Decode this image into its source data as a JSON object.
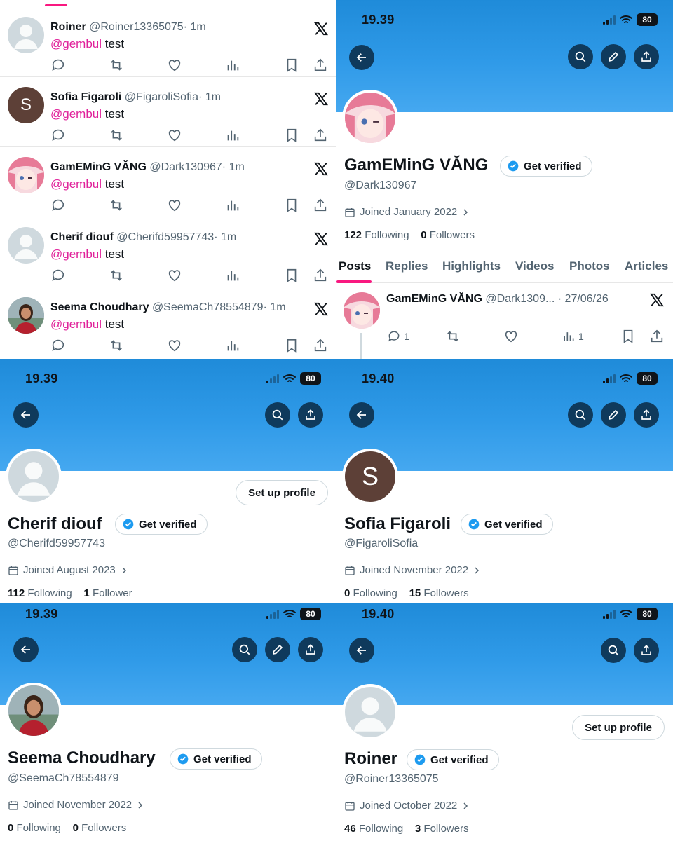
{
  "feed": {
    "tweets": [
      {
        "name": "Roiner",
        "handle": "@Roiner13365075",
        "time": "· 1m",
        "mention": "@gembul",
        "text": " test"
      },
      {
        "name": "Sofia Figaroli",
        "handle": "@FigaroliSofia",
        "time": "· 1m",
        "mention": "@gembul",
        "text": " test",
        "initial": "S"
      },
      {
        "name": "GamEMinG VĂNG",
        "handle": "@Dark130967",
        "time": "· 1m",
        "mention": "@gembul",
        "text": " test"
      },
      {
        "name": "Cherif diouf",
        "handle": "@Cherifd59957743",
        "time": "· 1m",
        "mention": "@gembul",
        "text": " test"
      },
      {
        "name": "Seema Choudhary",
        "handle": "@SeemaCh78554879",
        "time": "· 1m",
        "mention": "@gembul",
        "text": " test"
      }
    ]
  },
  "profiles": {
    "gaming": {
      "time": "19.39",
      "battery": "80",
      "name": "GamEMinG VĂNG",
      "verify_label": "Get verified",
      "handle": "@Dark130967",
      "joined": "Joined January 2022",
      "following_count": "122",
      "following_label": "Following",
      "followers_count": "0",
      "followers_label": "Followers",
      "tabs": [
        "Posts",
        "Replies",
        "Highlights",
        "Videos",
        "Photos",
        "Articles"
      ],
      "post": {
        "name": "GamEMinG VĂNG",
        "handle": "@Dark1309...",
        "date": "· 27/06/26",
        "replies": "1",
        "views": "1"
      }
    },
    "cherif": {
      "time": "19.39",
      "battery": "80",
      "name": "Cherif diouf",
      "verify_label": "Get verified",
      "handle": "@Cherifd59957743",
      "joined": "Joined August 2023",
      "setup_label": "Set up profile",
      "following_count": "112",
      "following_label": "Following",
      "followers_count": "1",
      "followers_label": "Follower"
    },
    "sofia": {
      "time": "19.40",
      "battery": "80",
      "name": "Sofia Figaroli",
      "verify_label": "Get verified",
      "handle": "@FigaroliSofia",
      "joined": "Joined November 2022",
      "initial": "S",
      "following_count": "0",
      "following_label": "Following",
      "followers_count": "15",
      "followers_label": "Followers"
    },
    "seema": {
      "time": "19.39",
      "battery": "80",
      "name": "Seema Choudhary",
      "verify_label": "Get verified",
      "handle": "@SeemaCh78554879",
      "joined": "Joined November 2022",
      "following_count": "0",
      "following_label": "Following",
      "followers_count": "0",
      "followers_label": "Followers"
    },
    "roiner": {
      "time": "19.40",
      "battery": "80",
      "name": "Roiner",
      "verify_label": "Get verified",
      "handle": "@Roiner13365075",
      "joined": "Joined October 2022",
      "setup_label": "Set up profile",
      "following_count": "46",
      "following_label": "Following",
      "followers_count": "3",
      "followers_label": "Followers"
    }
  },
  "colors": {
    "accent": "#f91880",
    "mention": "#e0219a",
    "verified": "#1d9bf0",
    "banner": "#2f9ae8",
    "button_bg": "#0f3a5c"
  },
  "icons": [
    "reply-icon",
    "retweet-icon",
    "like-icon",
    "views-icon",
    "bookmark-icon",
    "share-icon",
    "x-logo-icon",
    "back-arrow-icon",
    "search-icon",
    "edit-icon",
    "calendar-icon",
    "chevron-right-icon",
    "verified-badge-icon",
    "wifi-icon",
    "signal-icon",
    "battery-icon"
  ]
}
